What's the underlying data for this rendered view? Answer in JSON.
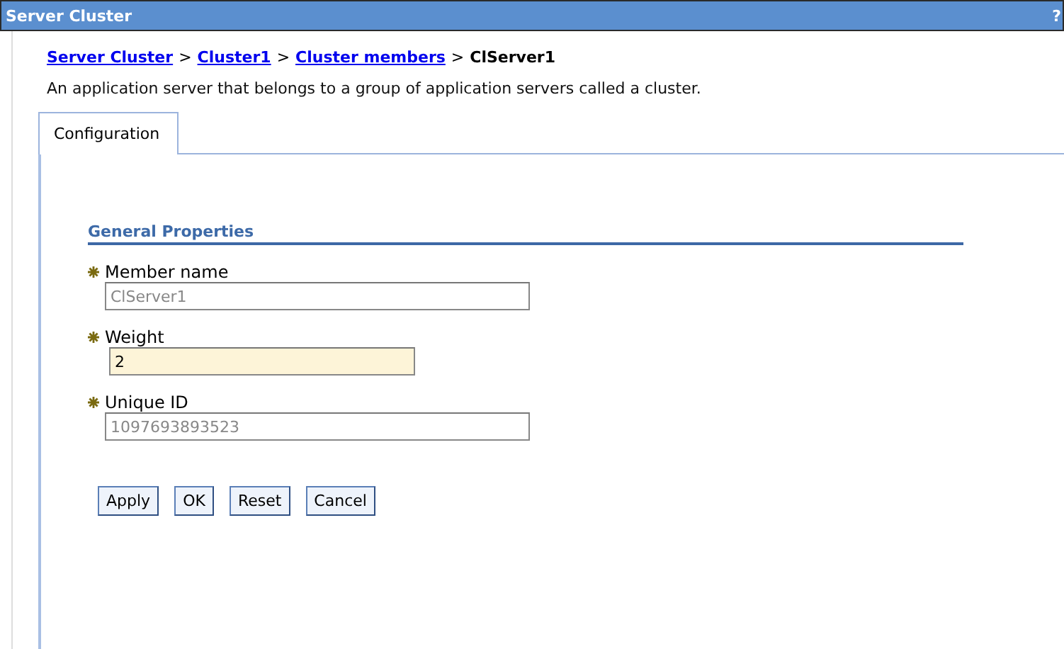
{
  "window": {
    "title": "Server Cluster",
    "help": "?"
  },
  "breadcrumb": {
    "links": [
      "Server Cluster",
      "Cluster1",
      "Cluster members"
    ],
    "separator": ">",
    "current": "ClServer1"
  },
  "description": "An application server that belongs to a group of application servers called a cluster.",
  "tabs": [
    {
      "label": "Configuration",
      "selected": true
    }
  ],
  "section": {
    "title": "General Properties"
  },
  "fields": [
    {
      "label": "Member name",
      "value": "ClServer1",
      "required": true,
      "readonly": true,
      "focused": false
    },
    {
      "label": "Weight",
      "value": "2",
      "required": true,
      "readonly": false,
      "focused": true
    },
    {
      "label": "Unique ID",
      "value": "1097693893523",
      "required": true,
      "readonly": true,
      "focused": false
    }
  ],
  "buttons": [
    "Apply",
    "OK",
    "Reset",
    "Cancel"
  ]
}
